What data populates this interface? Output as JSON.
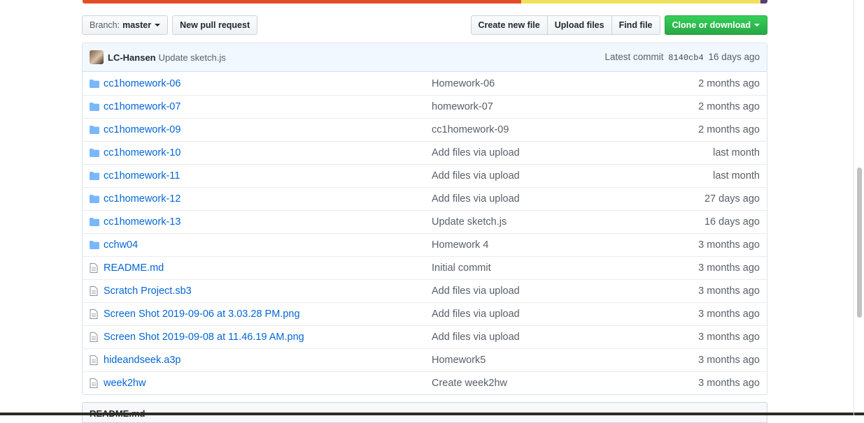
{
  "language_bar": [
    {
      "color": "#e34c26",
      "share": 0.64
    },
    {
      "color": "#f1e05a",
      "share": 0.35
    },
    {
      "color": "#563d7c",
      "share": 0.01
    }
  ],
  "toolbar": {
    "branch_prefix": "Branch:",
    "branch_name": "master",
    "new_pr": "New pull request",
    "create_file": "Create new file",
    "upload_files": "Upload files",
    "find_file": "Find file",
    "clone": "Clone or download"
  },
  "commit": {
    "author": "LC-Hansen",
    "message": "Update sketch.js",
    "latest_label": "Latest commit",
    "sha": "8140cb4",
    "age": "16 days ago"
  },
  "files": [
    {
      "icon": "folder-icon",
      "name": "cc1homework-06",
      "message": "Homework-06",
      "age": "2 months ago"
    },
    {
      "icon": "folder-icon",
      "name": "cc1homework-07",
      "message": "homework-07",
      "age": "2 months ago"
    },
    {
      "icon": "folder-icon",
      "name": "cc1homework-09",
      "message": "cc1homework-09",
      "age": "2 months ago"
    },
    {
      "icon": "folder-icon",
      "name": "cc1homework-10",
      "message": "Add files via upload",
      "age": "last month"
    },
    {
      "icon": "folder-icon",
      "name": "cc1homework-11",
      "message": "Add files via upload",
      "age": "last month"
    },
    {
      "icon": "folder-icon",
      "name": "cc1homework-12",
      "message": "Add files via upload",
      "age": "27 days ago"
    },
    {
      "icon": "folder-icon",
      "name": "cc1homework-13",
      "message": "Update sketch.js",
      "age": "16 days ago"
    },
    {
      "icon": "folder-icon",
      "name": "cchw04",
      "message": "Homework 4",
      "age": "3 months ago"
    },
    {
      "icon": "file-icon",
      "name": "README.md",
      "message": "Initial commit",
      "age": "3 months ago"
    },
    {
      "icon": "file-icon",
      "name": "Scratch Project.sb3",
      "message": "Add files via upload",
      "age": "3 months ago"
    },
    {
      "icon": "file-icon",
      "name": "Screen Shot 2019-09-06 at 3.03.28 PM.png",
      "message": "Add files via upload",
      "age": "3 months ago"
    },
    {
      "icon": "file-icon",
      "name": "Screen Shot 2019-09-08 at 11.46.19 AM.png",
      "message": "Add files via upload",
      "age": "3 months ago"
    },
    {
      "icon": "file-icon",
      "name": "hideandseek.a3p",
      "message": "Homework5",
      "age": "3 months ago"
    },
    {
      "icon": "file-icon",
      "name": "week2hw",
      "message": "Create week2hw",
      "age": "3 months ago"
    }
  ],
  "readme": {
    "title": "README.md"
  },
  "colors": {
    "link": "#0366d6",
    "muted": "#586069",
    "commit_bg": "#f1f8ff",
    "primary": "#28a745"
  }
}
